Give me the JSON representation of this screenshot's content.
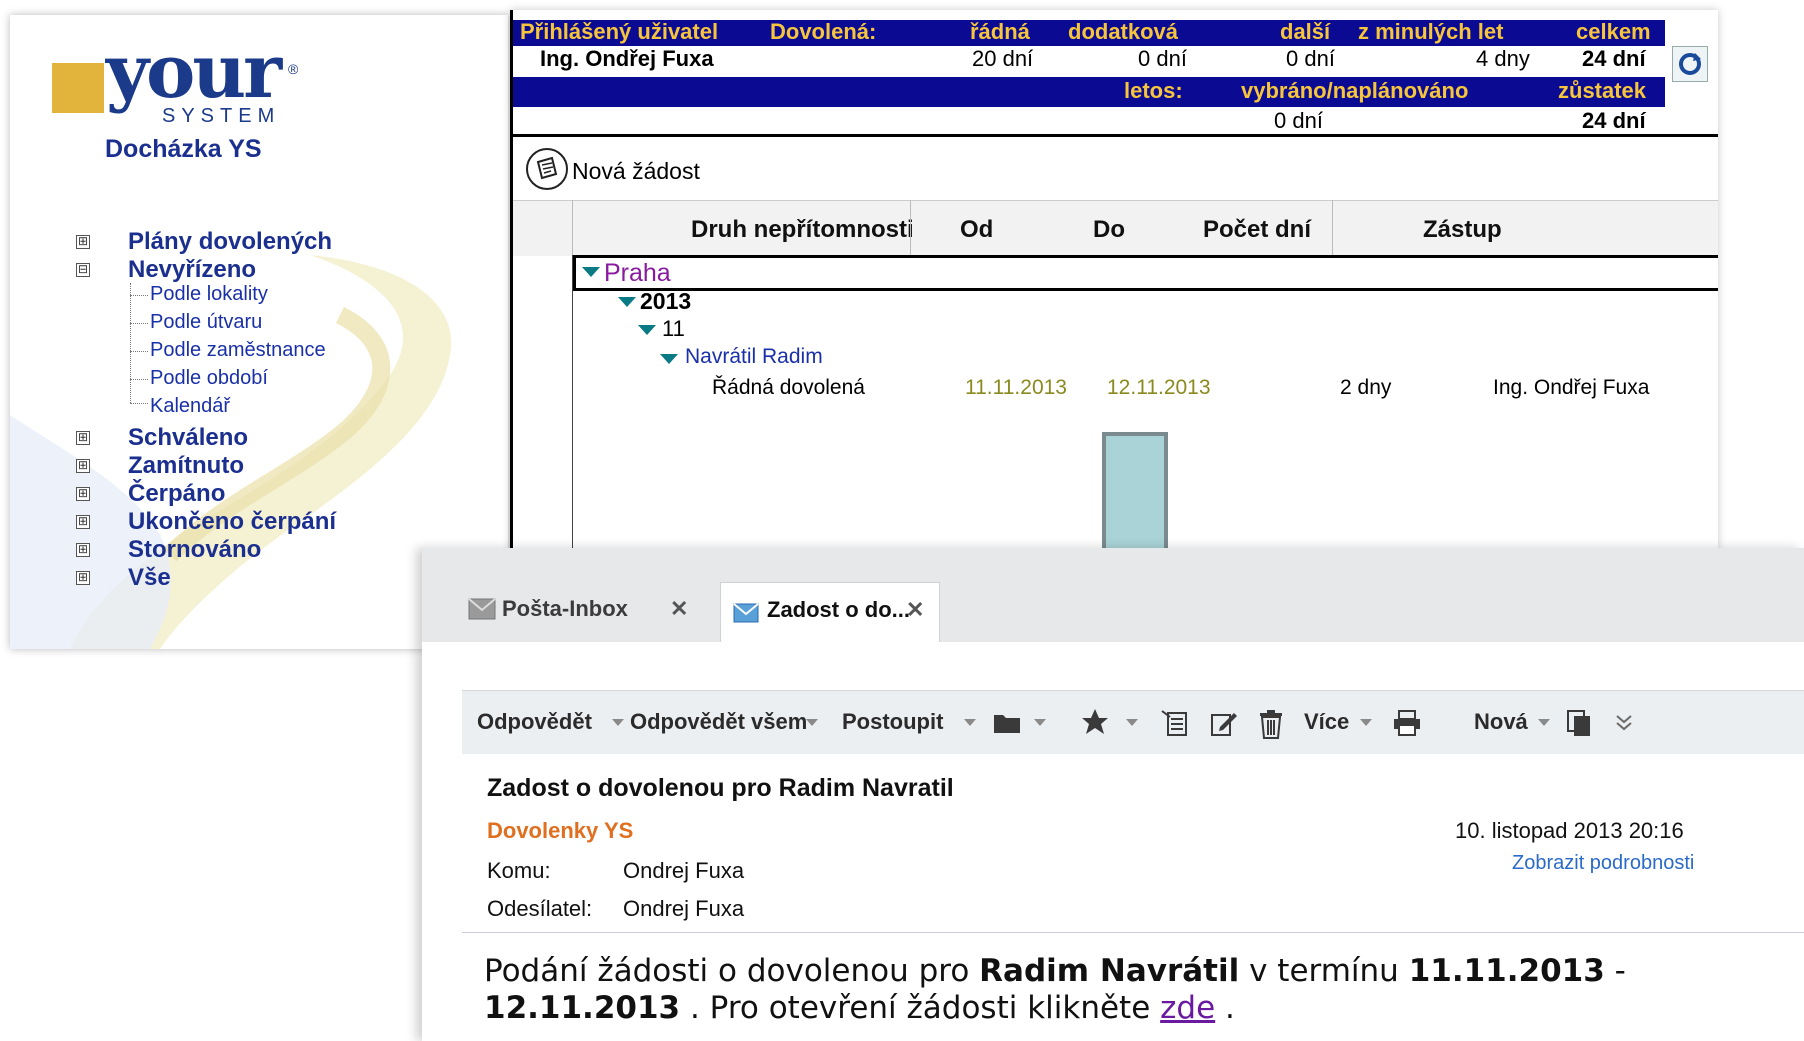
{
  "nav": {
    "logo_word": "your",
    "logo_reg": "®",
    "logo_system": "SYSTEM",
    "app_title": "Docházka YS",
    "items": [
      {
        "label": "Plány dovolených",
        "expander": "⊞"
      },
      {
        "label": "Nevyřízeno",
        "expander": "⊟"
      },
      {
        "label": "Schváleno",
        "expander": "⊞"
      },
      {
        "label": "Zamítnuto",
        "expander": "⊞"
      },
      {
        "label": "Čerpáno",
        "expander": "⊞"
      },
      {
        "label": "Ukončeno čerpání",
        "expander": "⊞"
      },
      {
        "label": "Stornováno",
        "expander": "⊞"
      },
      {
        "label": "Vše",
        "expander": "⊞"
      }
    ],
    "subitems": [
      "Podle lokality",
      "Podle útvaru",
      "Podle zaměstnance",
      "Podle období",
      "Kalendář"
    ]
  },
  "summary": {
    "headers": {
      "user": "Přihlášený uživatel",
      "leave": "Dovolená:",
      "regular": "řádná",
      "additional": "dodatková",
      "other": "další",
      "previous": "z minulých let",
      "total": "celkem"
    },
    "user_name": "Ing. Ondřej Fuxa",
    "regular": "20 dní",
    "additional": "0 dní",
    "other": "0 dní",
    "previous": "4 dny",
    "total": "24 dní",
    "headers2": {
      "this_year": "letos:",
      "taken": "vybráno/naplánováno",
      "balance": "zůstatek"
    },
    "taken": "0 dní",
    "balance": "24 dní"
  },
  "new_request": "Nová žádost",
  "grid": {
    "columns": [
      "Druh nepřítomnosti",
      "Od",
      "Do",
      "Počet dní",
      "Zástup"
    ],
    "group_location": "Praha",
    "group_year": "2013",
    "group_month": "11",
    "group_employee": "Navrátil Radim",
    "row": {
      "type": "Řádná dovolená",
      "from": "11.11.2013",
      "to": "12.11.2013",
      "days": "2 dny",
      "substitute": "Ing. Ondřej Fuxa"
    }
  },
  "mail": {
    "tabs": [
      {
        "label": "Pošta-Inbox",
        "close": "✕"
      },
      {
        "label": "Zadost o do...",
        "close": "✕"
      }
    ],
    "toolbar": {
      "reply": "Odpovědět",
      "reply_all": "Odpovědět všem",
      "forward": "Postoupit",
      "more": "Více",
      "new": "Nová"
    },
    "subject": "Zadost o dovolenou pro Radim Navratil",
    "sender": "Dovolenky YS",
    "date": "10. listopad 2013 20:16",
    "details_link": "Zobrazit podrobnosti",
    "to_label": "Komu:",
    "to_value": "Ondrej Fuxa",
    "from_label": "Odesílatel:",
    "from_value": "Ondrej Fuxa",
    "body": {
      "part1": "Podání žádosti o dovolenou pro ",
      "name": "Radim Navrátil",
      "part2": " v termínu ",
      "date_from": "11.11.2013",
      "dash": " - ",
      "date_to": "12.11.2013",
      "part3": " . Pro otevření žádosti klikněte ",
      "link": "zde",
      "part4": " ."
    }
  },
  "colors": {
    "header_bar": "#0a0a93",
    "header_text": "#f7c53c",
    "nav_text": "#1b2f8f",
    "group_praha": "#8a1aa0",
    "date_olive": "#8a8a20",
    "sender_orange": "#e07020",
    "arrow_fill": "#a9d3d6"
  }
}
